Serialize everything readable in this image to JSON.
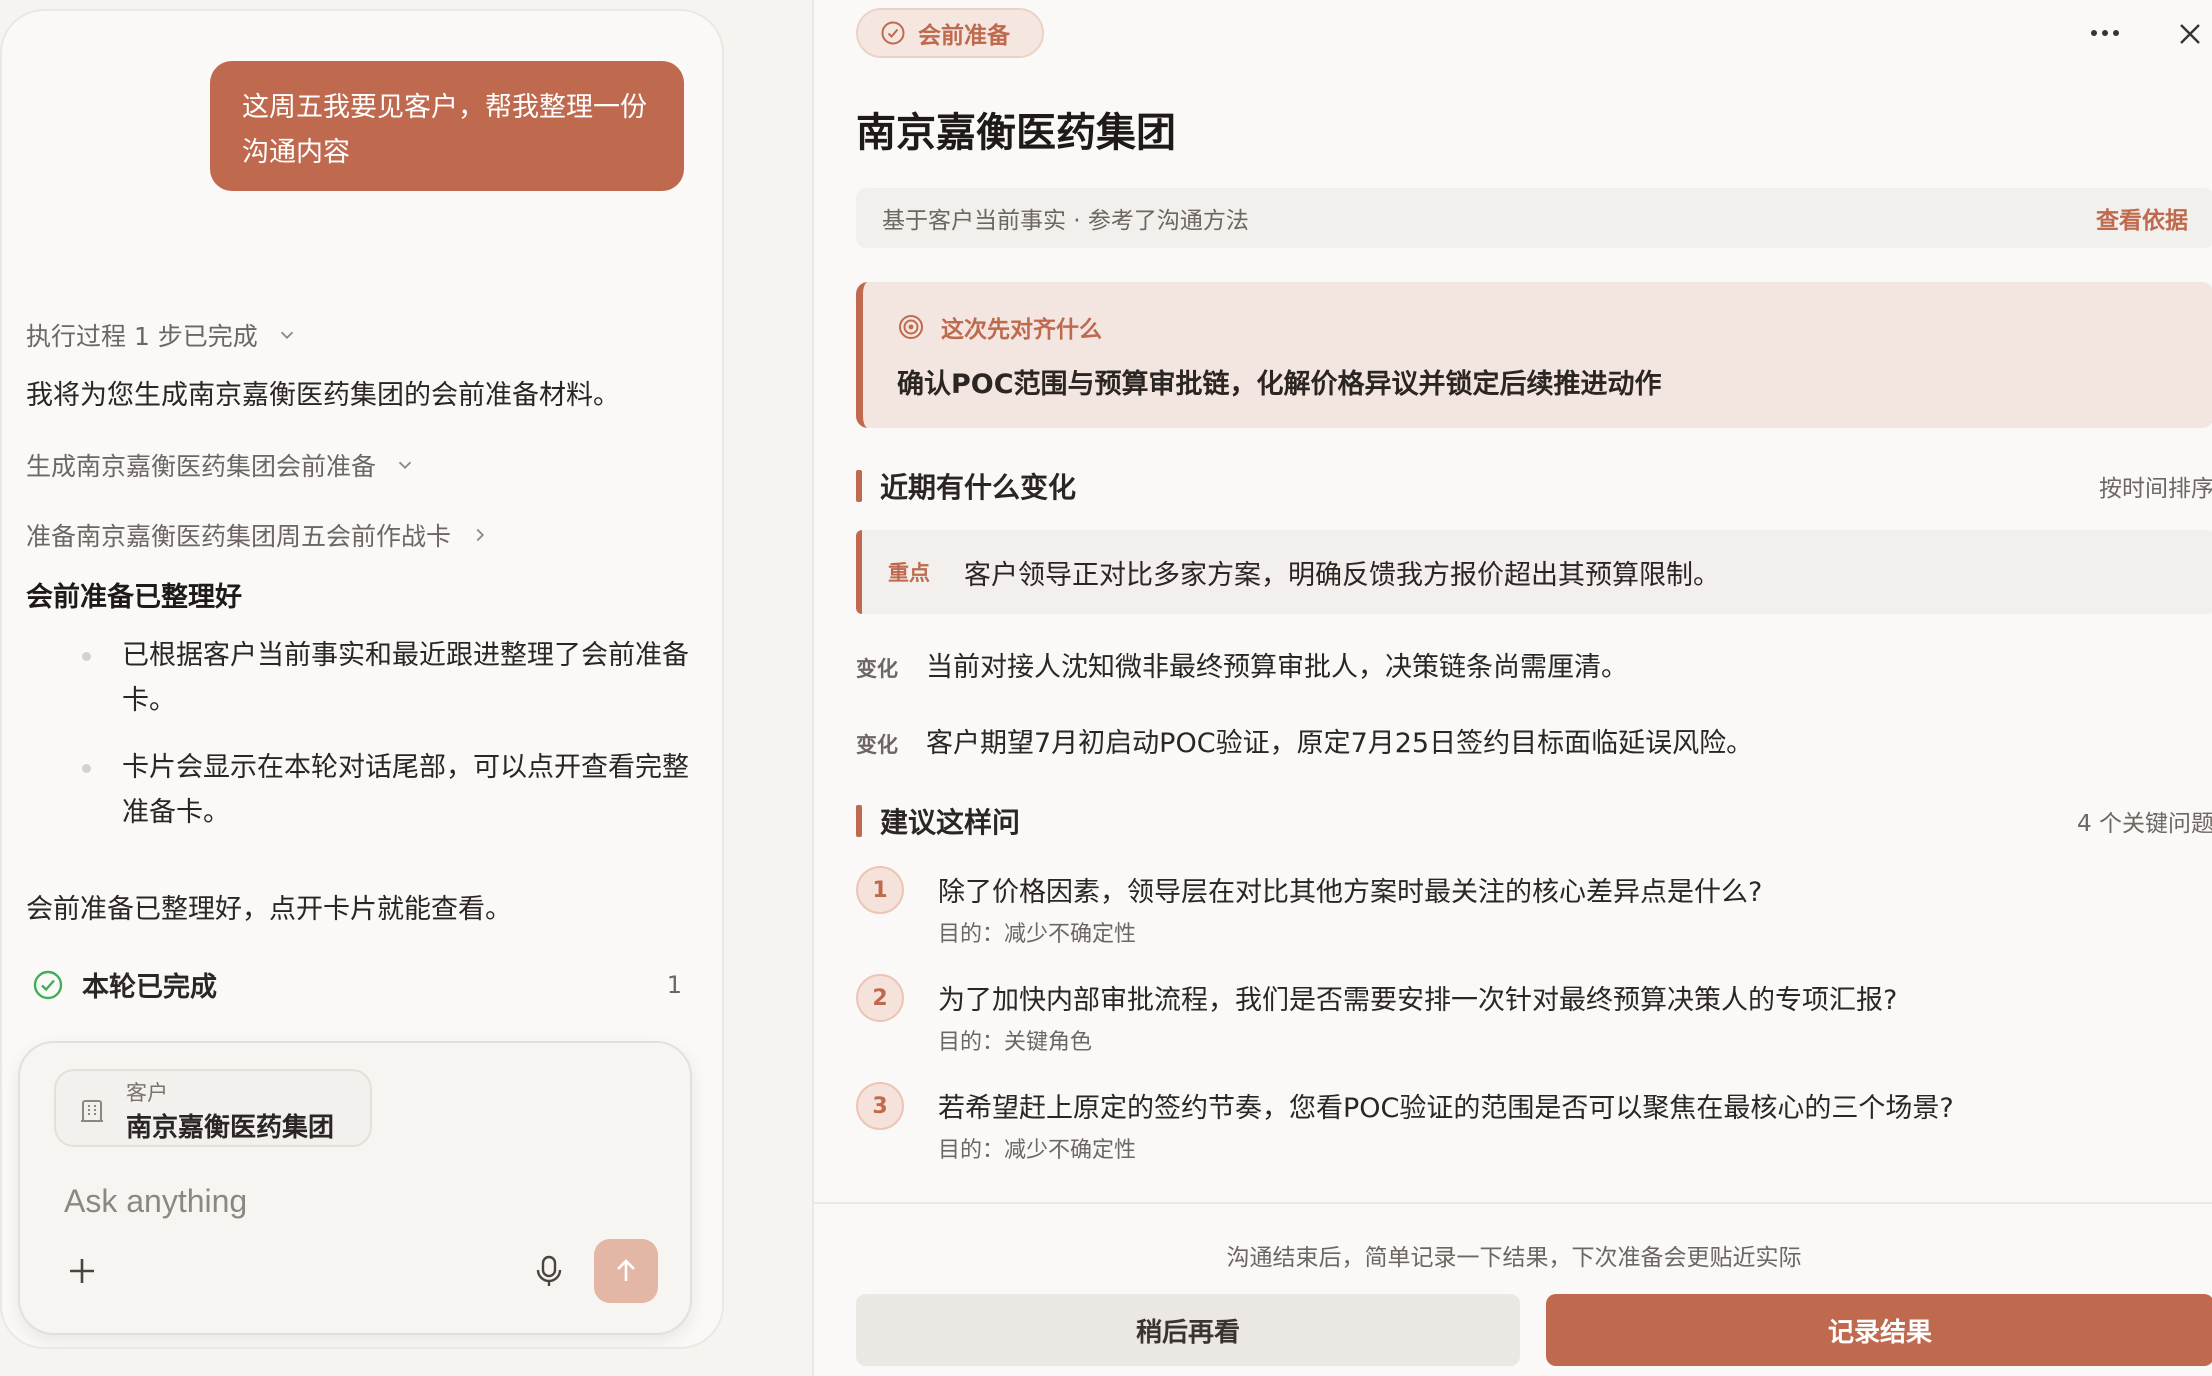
{
  "chat": {
    "user_message": "这周五我要见客户，帮我整理一份沟通内容",
    "steps": [
      {
        "label": "执行过程 1 步已完成",
        "chevron": "chevron-down-icon"
      },
      {
        "label": "生成南京嘉衡医药集团会前准备",
        "chevron": "chevron-down-icon"
      },
      {
        "label": "准备南京嘉衡医药集团周五会前作战卡",
        "chevron": "chevron-right-icon"
      }
    ],
    "reply_intro": "我将为您生成南京嘉衡医药集团的会前准备材料。",
    "ready_heading": "会前准备已整理好",
    "bullets": [
      "已根据客户当前事实和最近跟进整理了会前准备卡。",
      "卡片会显示在本轮对话尾部，可以点开查看完整准备卡。"
    ],
    "closing": "会前准备已整理好，点开卡片就能查看。",
    "done_label": "本轮已完成",
    "done_count": "1"
  },
  "composer": {
    "context_label": "客户",
    "context_value": "南京嘉衡医药集团",
    "placeholder": "Ask anything"
  },
  "prep": {
    "badge": "会前准备",
    "title": "南京嘉衡医药集团",
    "basis_text": "基于客户当前事实 · 参考了沟通方法",
    "basis_link": "查看依据",
    "goal_heading": "这次先对齐什么",
    "goal_body": "确认POC范围与预算审批链，化解价格异议并锁定后续推进动作",
    "changes_title": "近期有什么变化",
    "changes_sort": "按时间排序",
    "key_tag": "重点",
    "key_text": "客户领导正对比多家方案，明确反馈我方报价超出其预算限制。",
    "changes": [
      {
        "tag": "变化",
        "text": "当前对接人沈知微非最终预算审批人，决策链条尚需厘清。"
      },
      {
        "tag": "变化",
        "text": "客户期望7月初启动POC验证，原定7月25日签约目标面临延误风险。"
      }
    ],
    "questions_title": "建议这样问",
    "questions_count": "4 个关键问题",
    "questions": [
      {
        "num": "1",
        "q": "除了价格因素，领导层在对比其他方案时最关注的核心差异点是什么?",
        "purpose": "目的：减少不确定性"
      },
      {
        "num": "2",
        "q": "为了加快内部审批流程，我们是否需要安排一次针对最终预算决策人的专项汇报?",
        "purpose": "目的：关键角色"
      },
      {
        "num": "3",
        "q": "若希望赶上原定的签约节奏，您看POC验证的范围是否可以聚焦在最核心的三个场景?",
        "purpose": "目的：减少不确定性"
      }
    ],
    "footer_note": "沟通结束后，简单记录一下结果，下次准备会更贴近实际",
    "btn_later": "稍后再看",
    "btn_record": "记录结果"
  },
  "colors": {
    "accent": "#bf6a4e",
    "success": "#3fae5a"
  }
}
